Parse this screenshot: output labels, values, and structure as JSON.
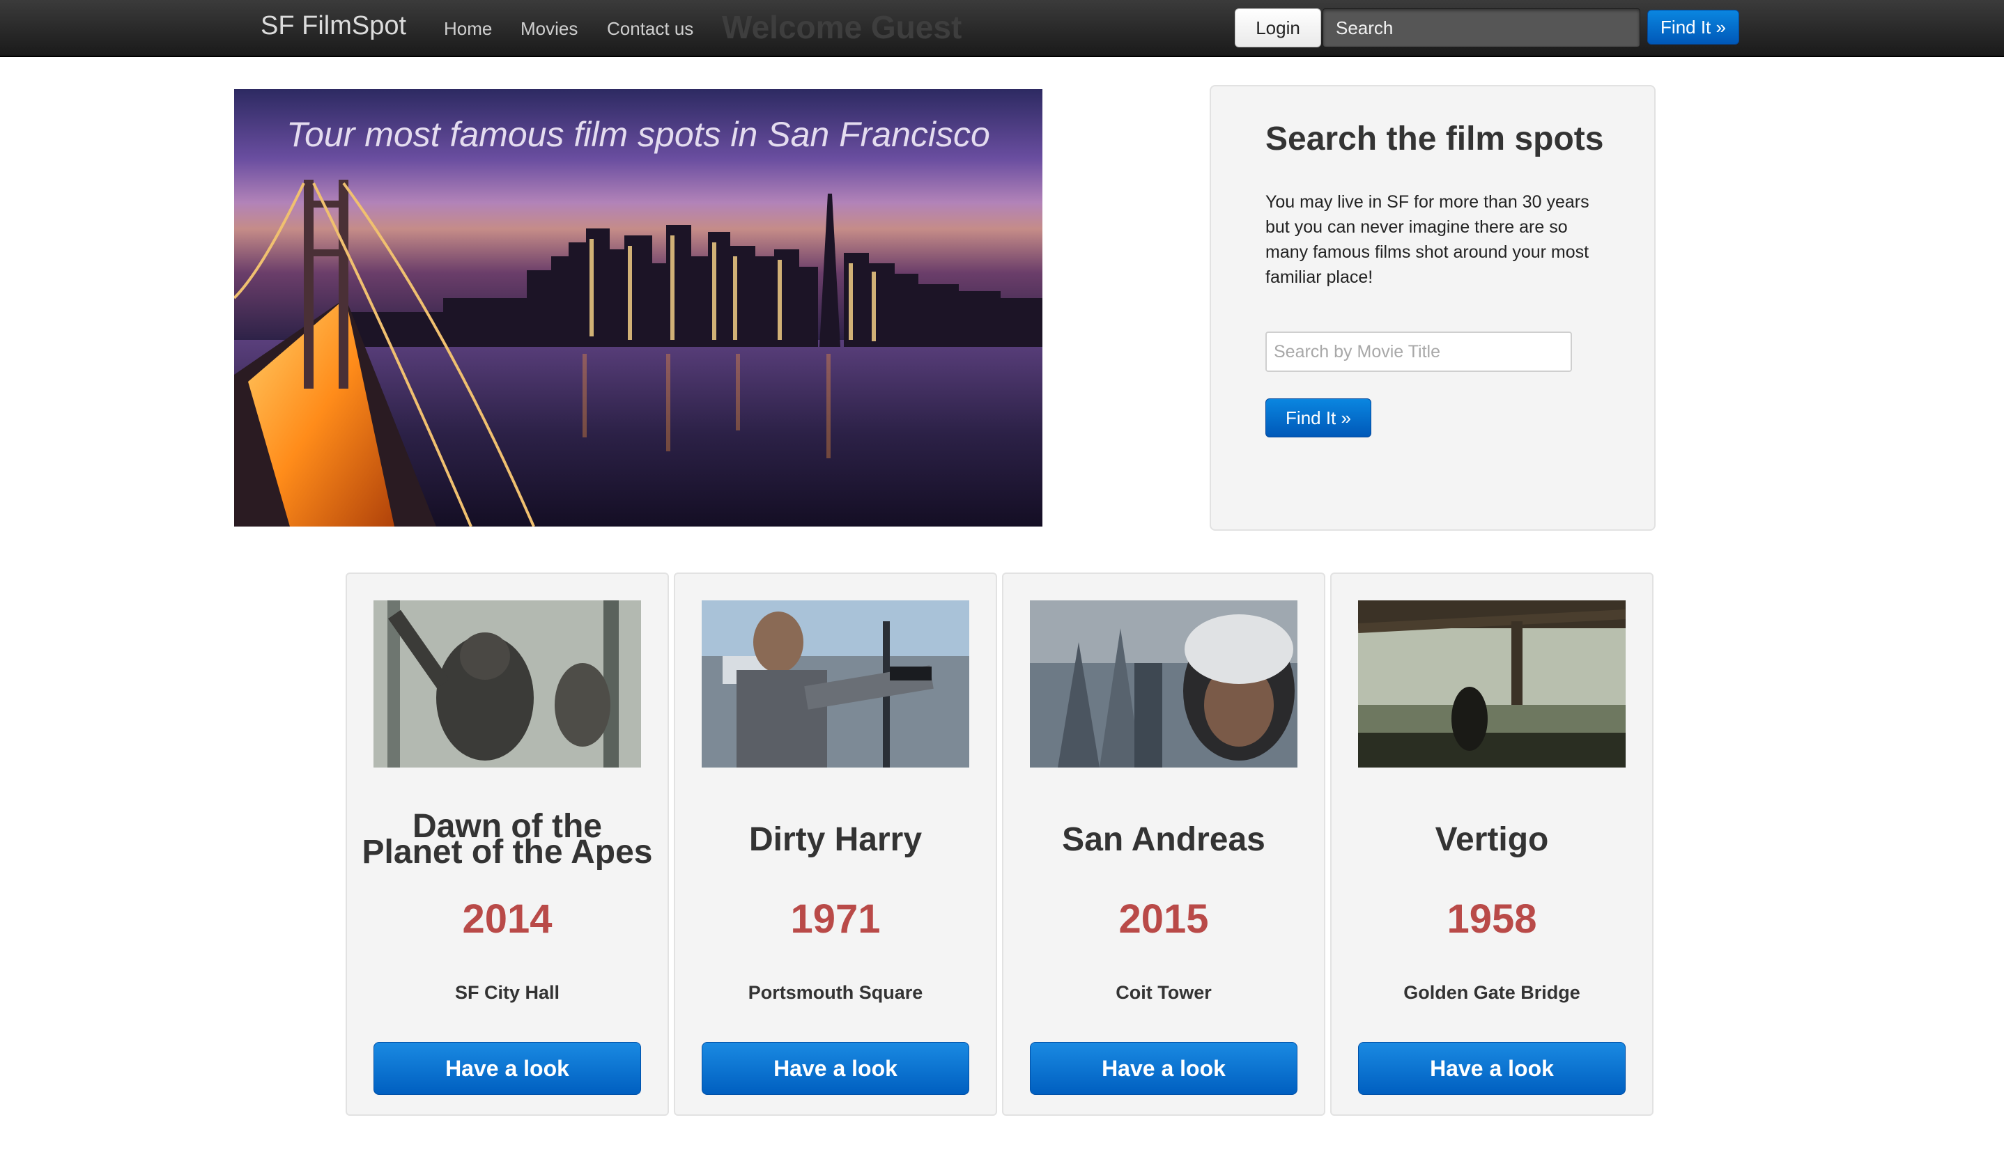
{
  "navbar": {
    "brand": "SF FilmSpot",
    "links": [
      "Home",
      "Movies",
      "Contact us"
    ],
    "welcome": "Welcome Guest",
    "login_label": "Login",
    "search_value": "Search",
    "find_label": "Find It »"
  },
  "hero": {
    "caption": "Tour most famous film spots in San Francisco"
  },
  "search_panel": {
    "title": "Search the film spots",
    "text": "You may live in SF for more than 30 years but you can never imagine there are so many famous films shot around your most familiar place!",
    "input_placeholder": "Search by Movie Title",
    "button_label": "Find It »"
  },
  "movies": [
    {
      "title": "Dawn of the Planet of the Apes",
      "year": "2014",
      "location": "SF City Hall",
      "button_label": "Have a look"
    },
    {
      "title": "Dirty Harry",
      "year": "1971",
      "location": "Portsmouth Square",
      "button_label": "Have a look"
    },
    {
      "title": "San Andreas",
      "year": "2015",
      "location": "Coit Tower",
      "button_label": "Have a look"
    },
    {
      "title": "Vertigo",
      "year": "1958",
      "location": "Golden Gate Bridge",
      "button_label": "Have a look"
    }
  ],
  "colors": {
    "accent_blue": "#0a6fd1",
    "year_red": "#b94a48",
    "navbar_dark": "#222222",
    "panel_bg": "#f4f4f4"
  }
}
